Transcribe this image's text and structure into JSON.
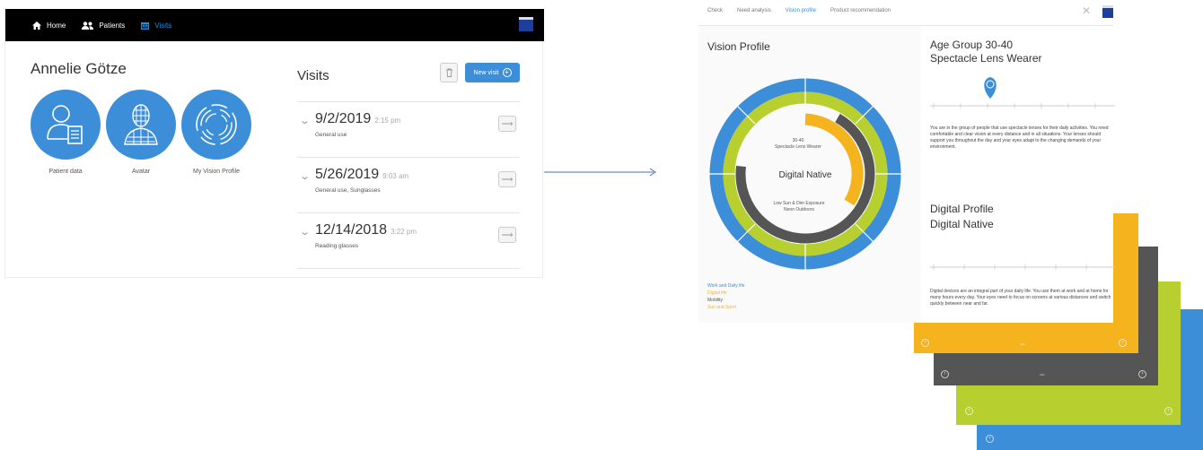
{
  "left_app": {
    "nav": {
      "items": [
        {
          "label": "Home",
          "icon": "home-icon"
        },
        {
          "label": "Patients",
          "icon": "patients-icon"
        },
        {
          "label": "Visits",
          "icon": "calendar-icon",
          "active": true
        }
      ],
      "logo": "zeiss-logo"
    },
    "patient_name": "Annelie Götze",
    "profile_buttons": [
      {
        "label": "Patient data",
        "icon": "patient-data-icon"
      },
      {
        "label": "Avatar",
        "icon": "avatar-icon"
      },
      {
        "label": "My Vision Profile",
        "icon": "vision-profile-icon"
      }
    ],
    "visits": {
      "title": "Visits",
      "new_visit_label": "New visit",
      "rows": [
        {
          "date": "9/2/2019",
          "time": "2:15 pm",
          "description": "General use"
        },
        {
          "date": "5/26/2019",
          "time": "9:03 am",
          "description": "General use, Sunglasses"
        },
        {
          "date": "12/14/2018",
          "time": "3:22 pm",
          "description": "Reading glasses"
        }
      ]
    }
  },
  "right_app": {
    "tabs": [
      {
        "label": "Check",
        "active": false
      },
      {
        "label": "Need analysis",
        "active": false
      },
      {
        "label": "Vision profile",
        "active": true
      },
      {
        "label": "Product recommendation",
        "active": false
      }
    ],
    "vision_profile_title": "Vision Profile",
    "ring": {
      "top_label_line1": "30-40",
      "top_label_line2": "Spectacle Lens Wearer",
      "center_label": "Digital Native",
      "bottom_label_line1": "Low Sun & Dim Exposure",
      "bottom_label_line2": "Neon Outdoors"
    },
    "legend": [
      {
        "text": "Work and Daily life",
        "color": "#3d8ed8"
      },
      {
        "text": "Digital life",
        "color": "#f5b31e"
      },
      {
        "text": "Mobility",
        "color": "#555555"
      },
      {
        "text": "Sun and Sport",
        "color": "#f5b31e"
      }
    ],
    "age_group_line1": "Age Group 30-40",
    "age_group_line2": "Spectacle Lens Wearer",
    "age_description": "You are in the group of people that use spectacle lenses for their daily activities. You need comfortable and clear vision at every distance and in all situations. Your lenses should support you throughout the day and your eyes adapt to the changing demands of your environment.",
    "digital_profile_line1": "Digital Profile",
    "digital_profile_line2": "Digital Native",
    "digital_description": "Digital devices are an integral part of your daily life. You use them at work and at home for many hours every day. Your eyes need to focus on screens at various distances and switch quickly between near and far.",
    "colors": {
      "blue": "#3d8ed8",
      "green": "#b7cf2f",
      "dark": "#555555",
      "orange": "#f5b31e"
    }
  }
}
